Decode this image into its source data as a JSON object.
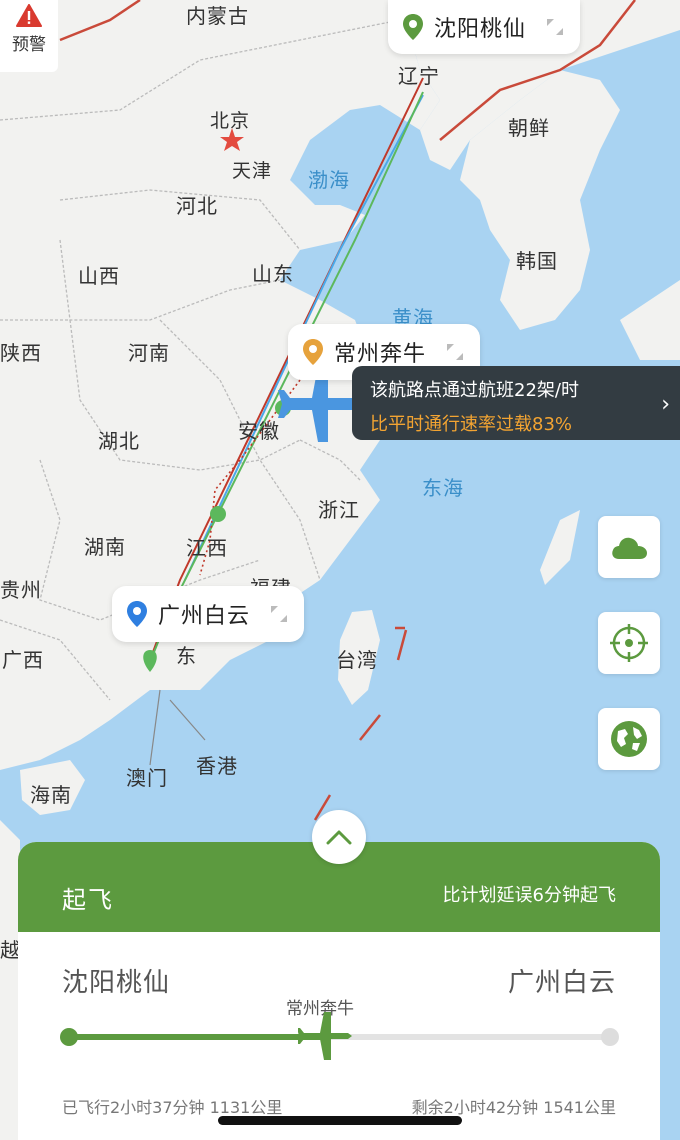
{
  "warning": {
    "label": "预警"
  },
  "map_labels": {
    "inner_mongolia": "内蒙古",
    "beijing": "北京",
    "tianjin": "天津",
    "hebei": "河北",
    "shanxi": "山西",
    "shandong": "山东",
    "shaanxi": "陕西",
    "henan": "河南",
    "anhui": "安徽",
    "hubei": "湖北",
    "jiangxi": "江西",
    "hunan": "湖南",
    "zhejiang": "浙江",
    "fujian": "福建",
    "guizhou": "贵州",
    "guangxi": "广西",
    "guangdong_partial": "东",
    "taiwan": "台湾",
    "hainan": "海南",
    "macau": "澳门",
    "hongkong": "香港",
    "liaoning": "辽宁",
    "north_korea": "朝鲜",
    "south_korea": "韩国",
    "bohai": "渤海",
    "yellow_sea": "黄海",
    "east_sea": "东海",
    "vietnam_partial": "越南"
  },
  "airports": {
    "origin": {
      "name": "沈阳桃仙",
      "pin_color": "#5c9a3f"
    },
    "waypoint": {
      "name": "常州奔牛",
      "pin_color": "#e6a23c"
    },
    "destination": {
      "name": "广州白云",
      "pin_color": "#2f7fe0"
    }
  },
  "callout": {
    "line1": "该航路点通过航班22架/时",
    "line2": "比平时通行速率过载83%"
  },
  "side_buttons": [
    "weather-icon",
    "locate-icon",
    "globe-icon"
  ],
  "panel": {
    "status": "起飞",
    "delay": "比计划延误6分钟起飞",
    "from": "沈阳桃仙",
    "to": "广州白云",
    "via": "常州奔牛",
    "progress": 0.47,
    "flown": "已飞行2小时37分钟 1131公里",
    "remaining": "剩余2小时42分钟 1541公里"
  },
  "colors": {
    "accent": "#5c9a3f",
    "callout_bg": "#333c42",
    "overload": "#f3a432",
    "sea": "#a9d3f2",
    "land": "#f2f2f0"
  }
}
